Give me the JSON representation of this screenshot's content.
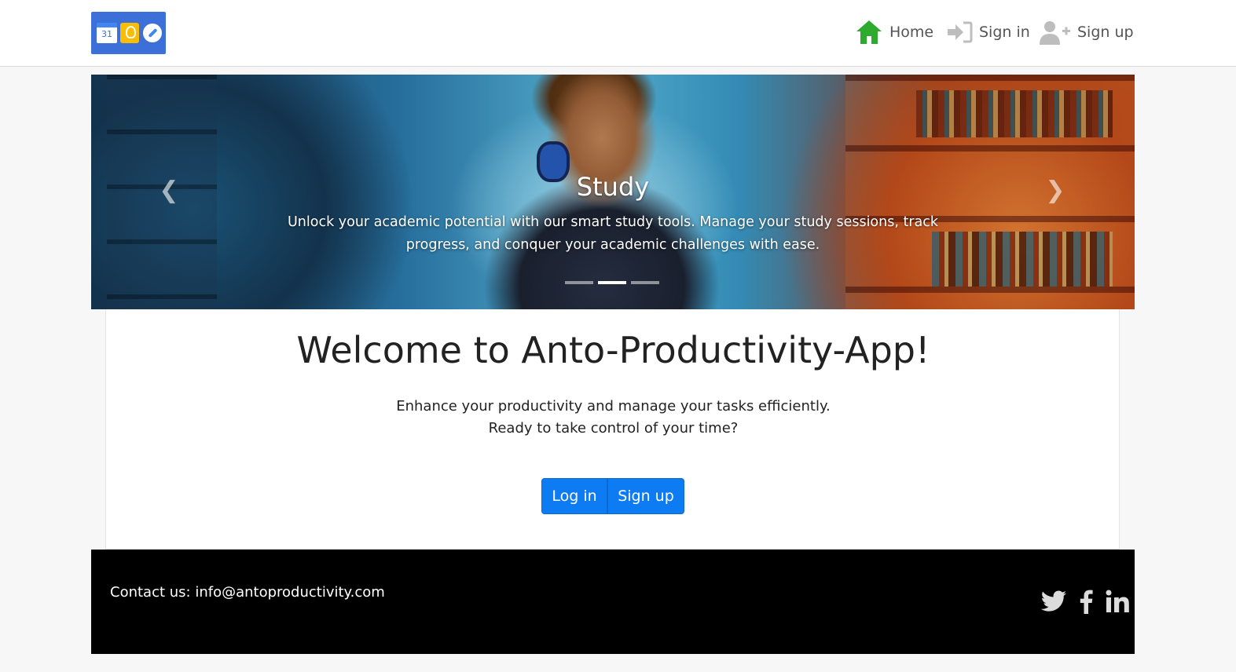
{
  "nav": {
    "logo_calendar_day": "31",
    "items": [
      {
        "label": "Home",
        "icon": "home-icon",
        "icon_color": "#2eaa2e"
      },
      {
        "label": "Sign in",
        "icon": "sign-in-icon",
        "icon_color": "#bdbdbd"
      },
      {
        "label": "Sign up",
        "icon": "user-plus-icon",
        "icon_color": "#bdbdbd"
      }
    ]
  },
  "carousel": {
    "title": "Study",
    "text": "Unlock your academic potential with our smart study tools. Manage your study sessions, track progress, and conquer your academic challenges with ease.",
    "slide_count": 3,
    "active_slide": 2,
    "prev_icon": "chevron-left-icon",
    "next_icon": "chevron-right-icon"
  },
  "welcome": {
    "title": "Welcome to Anto-Productivity-App!",
    "line1": "Enhance your productivity and manage your tasks efficiently.",
    "line2": "Ready to take control of your time?",
    "login_label": "Log in",
    "signup_label": "Sign up",
    "button_color": "#0d7cf2"
  },
  "footer": {
    "contact": "Contact us: info@antoproductivity.com",
    "social": [
      {
        "icon": "twitter-icon"
      },
      {
        "icon": "facebook-icon"
      },
      {
        "icon": "linkedin-icon"
      }
    ],
    "background": "#000000"
  }
}
